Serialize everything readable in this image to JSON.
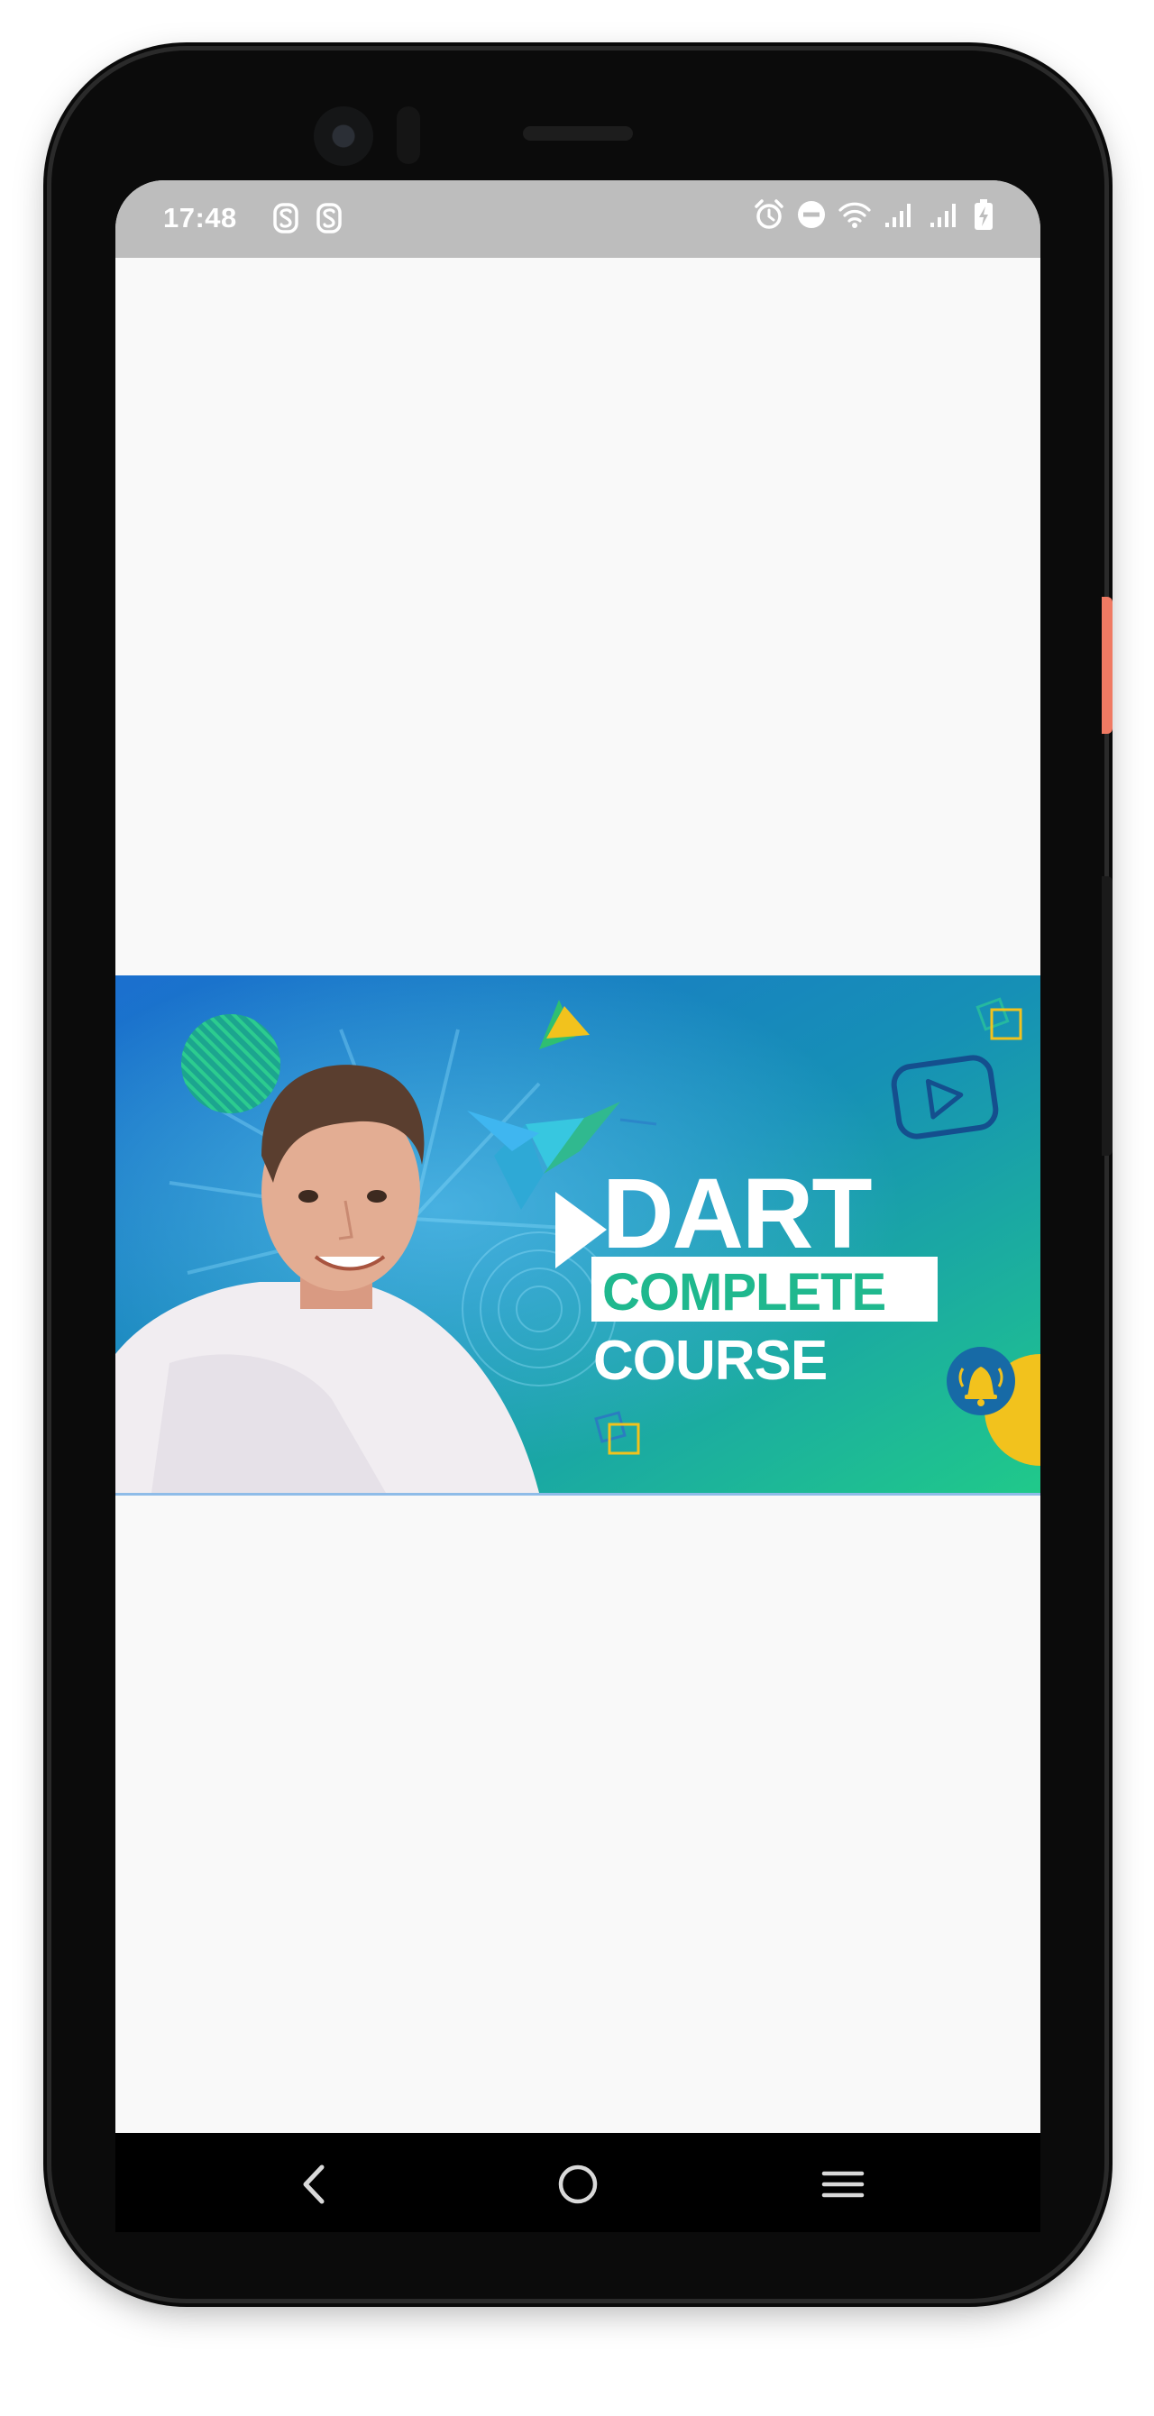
{
  "status_bar": {
    "time": "17:48",
    "left_icons": [
      "notification-s-icon",
      "notification-s-icon"
    ],
    "right_icons": [
      "alarm-icon",
      "do-not-disturb-icon",
      "wifi-icon",
      "signal-icon",
      "signal-icon",
      "battery-charging-icon"
    ]
  },
  "banner": {
    "title_line1": "DART",
    "title_line2": "COMPLETE",
    "title_line3": "COURSE",
    "icons": [
      "play-triangle-icon",
      "hummingbird-icon",
      "youtube-play-icon",
      "bell-icon"
    ],
    "colors": {
      "gradient_start": "#1d73c9",
      "gradient_end": "#1fc08a",
      "accent_yellow": "#f2c21d",
      "title_white": "#ffffff",
      "complete_text": "#1fb88e"
    }
  },
  "nav_bar": {
    "buttons": [
      "back-icon",
      "home-icon",
      "recents-icon"
    ]
  }
}
